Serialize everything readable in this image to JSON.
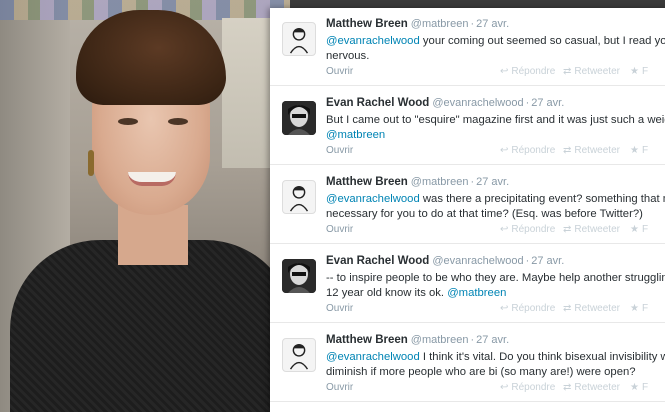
{
  "tweets": [
    {
      "name": "Matthew Breen",
      "handle": "@matbreen",
      "time": "27 avr.",
      "line1_mention": "@evanrachelwood",
      "line1_text": " your coming out seemed so casual, but I read you w",
      "line2_text": "nervous.",
      "line2_mention": "",
      "avatar": "sketch-man-avatar"
    },
    {
      "name": "Evan Rachel Wood",
      "handle": "@evanrachelwood",
      "time": "27 avr.",
      "line1_mention": "",
      "line1_text": "But I came out to \"esquire\" magazine first and it was just such a weight",
      "line2_text": "",
      "line2_mention": "@matbreen",
      "avatar": "bw-portrait-avatar"
    },
    {
      "name": "Matthew Breen",
      "handle": "@matbreen",
      "time": "27 avr.",
      "line1_mention": "@evanrachelwood",
      "line1_text": " was there a precipitating event? something that ma",
      "line2_text": "necessary for you to do at that time? (Esq. was before Twitter?)",
      "line2_mention": "",
      "avatar": "sketch-man-avatar"
    },
    {
      "name": "Evan Rachel Wood",
      "handle": "@evanrachelwood",
      "time": "27 avr.",
      "line1_mention": "",
      "line1_text": "-- to inspire people to be who they are. Maybe help another struggling",
      "line2_text": "12 year old know its ok. ",
      "line2_mention": "@matbreen",
      "avatar": "bw-portrait-avatar"
    },
    {
      "name": "Matthew Breen",
      "handle": "@matbreen",
      "time": "27 avr.",
      "line1_mention": "@evanrachelwood",
      "line1_text": " I think it's vital. Do you think bisexual invisibility wou",
      "line2_text": "diminish if more people who are bi (so many are!) were open?",
      "line2_mention": "",
      "avatar": "sketch-man-avatar"
    }
  ],
  "actions": {
    "open": "Ouvrir",
    "reply": "Répondre",
    "retweet": "Retweeter",
    "favorite": "F"
  },
  "icons": {
    "reply": "reply-icon",
    "retweet": "retweet-icon",
    "favorite": "star-icon"
  },
  "colors": {
    "link": "#0084b4",
    "name": "#292f33",
    "meta": "#8899a6"
  }
}
